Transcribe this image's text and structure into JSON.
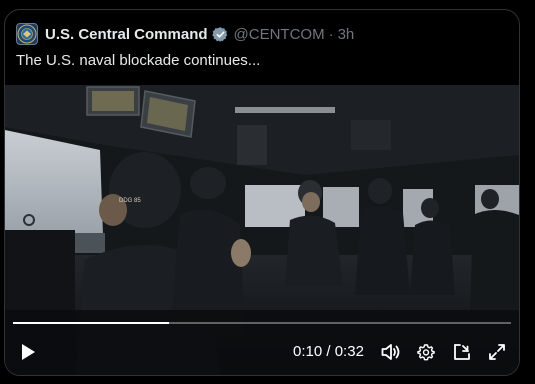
{
  "tweet": {
    "author_name": "U.S. Central Command",
    "handle": "@CENTCOM",
    "separator": "·",
    "time": "3h",
    "text": "The U.S. naval blockade continues..."
  },
  "avatar": {
    "icon": "centcom-seal-icon"
  },
  "video": {
    "current_time": "0:10",
    "time_separator": " / ",
    "duration": "0:32",
    "progress_fraction": 0.3125,
    "hull_marking": "DDG 85",
    "icons": [
      "play-icon",
      "volume-icon",
      "settings-gear-icon",
      "pip-icon",
      "fullscreen-icon"
    ]
  },
  "colors": {
    "background": "#000000",
    "text_primary": "#e7e9ea",
    "text_secondary": "#71767b",
    "verified_badge": "#829aab",
    "card_border": "#2f3336"
  }
}
